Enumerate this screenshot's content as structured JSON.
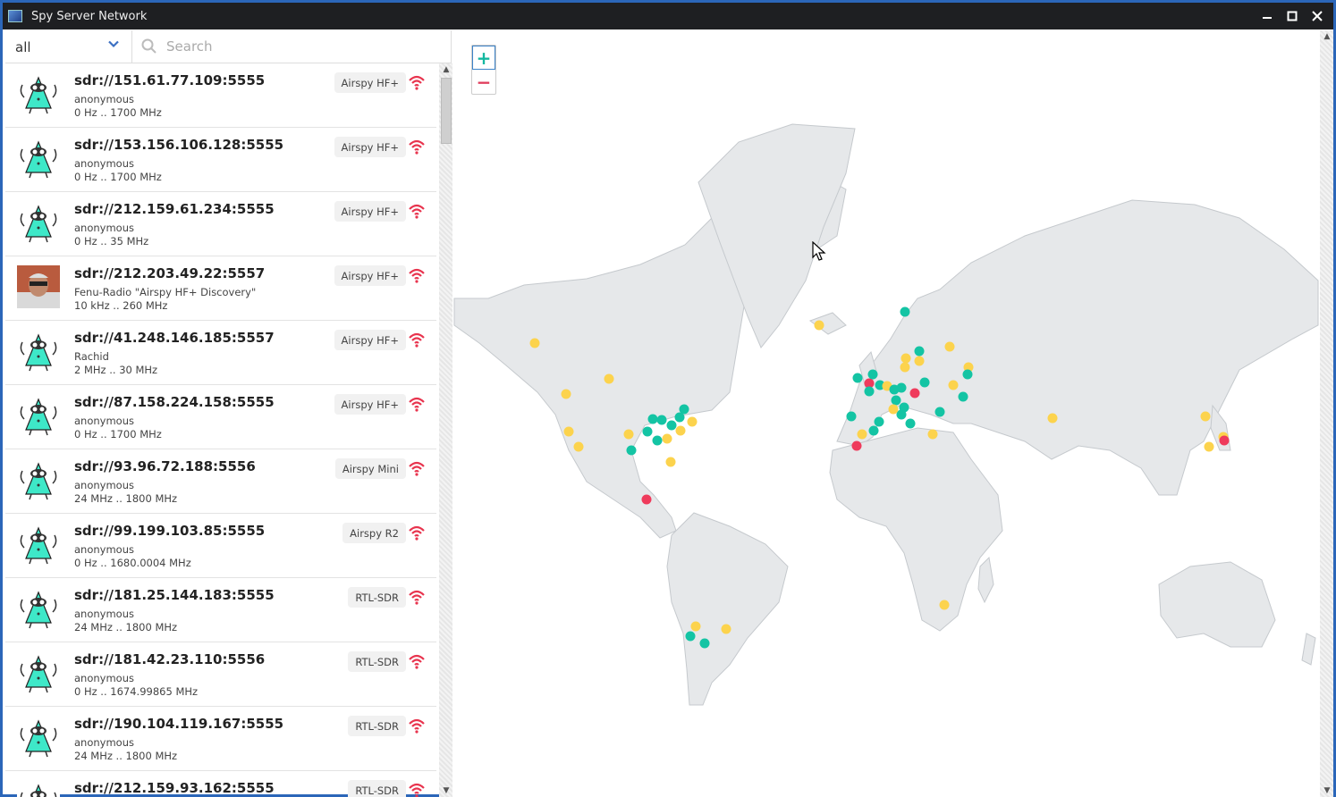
{
  "window": {
    "title": "Spy Server Network",
    "minimize": "—",
    "maximize": "□",
    "close": "✕"
  },
  "filter": {
    "value": "all"
  },
  "search": {
    "placeholder": "Search"
  },
  "servers": [
    {
      "address": "sdr://151.61.77.109:5555",
      "owner": "anonymous",
      "range": "0 Hz .. 1700 MHz",
      "device": "Airspy HF+",
      "avatar": "robot-avatar"
    },
    {
      "address": "sdr://153.156.106.128:5555",
      "owner": "anonymous",
      "range": "0 Hz .. 1700 MHz",
      "device": "Airspy HF+",
      "avatar": "robot-avatar"
    },
    {
      "address": "sdr://212.159.61.234:5555",
      "owner": "anonymous",
      "range": "0 Hz .. 35 MHz",
      "device": "Airspy HF+",
      "avatar": "robot-avatar"
    },
    {
      "address": "sdr://212.203.49.22:5557",
      "owner": "Fenu-Radio \"Airspy HF+ Discovery\"",
      "range": "10 kHz .. 260 MHz",
      "device": "Airspy HF+",
      "avatar": "photo-avatar"
    },
    {
      "address": "sdr://41.248.146.185:5557",
      "owner": "Rachid",
      "range": "2 MHz .. 30 MHz",
      "device": "Airspy HF+",
      "avatar": "robot-avatar"
    },
    {
      "address": "sdr://87.158.224.158:5555",
      "owner": "anonymous",
      "range": "0 Hz .. 1700 MHz",
      "device": "Airspy HF+",
      "avatar": "robot-avatar"
    },
    {
      "address": "sdr://93.96.72.188:5556",
      "owner": "anonymous",
      "range": "24 MHz .. 1800 MHz",
      "device": "Airspy Mini",
      "avatar": "robot-avatar"
    },
    {
      "address": "sdr://99.199.103.85:5555",
      "owner": "anonymous",
      "range": "0 Hz .. 1680.0004 MHz",
      "device": "Airspy R2",
      "avatar": "robot-avatar"
    },
    {
      "address": "sdr://181.25.144.183:5555",
      "owner": "anonymous",
      "range": "24 MHz .. 1800 MHz",
      "device": "RTL-SDR",
      "avatar": "robot-avatar"
    },
    {
      "address": "sdr://181.42.23.110:5556",
      "owner": "anonymous",
      "range": "0 Hz .. 1674.99865 MHz",
      "device": "RTL-SDR",
      "avatar": "robot-avatar"
    },
    {
      "address": "sdr://190.104.119.167:5555",
      "owner": "anonymous",
      "range": "24 MHz .. 1800 MHz",
      "device": "RTL-SDR",
      "avatar": "robot-avatar"
    },
    {
      "address": "sdr://212.159.93.162:5555",
      "owner": "",
      "range": "",
      "device": "RTL-SDR",
      "avatar": "robot-avatar"
    }
  ],
  "map": {
    "zoom_in": "+",
    "zoom_out": "−",
    "colors": {
      "yellow": "#fcd34d",
      "teal": "#14c4a4",
      "red": "#ef3b5c",
      "land": "#e6e8ea",
      "wifi": "#e8344e"
    }
  }
}
